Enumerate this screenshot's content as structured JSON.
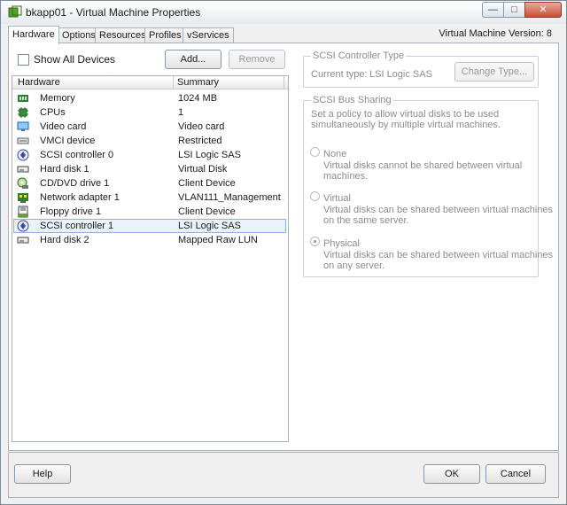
{
  "window": {
    "title": "bkapp01 - Virtual Machine Properties",
    "minimize": "—",
    "maximize": "□",
    "close": "✕"
  },
  "tabs": [
    {
      "label": "Hardware",
      "active": true
    },
    {
      "label": "Options"
    },
    {
      "label": "Resources"
    },
    {
      "label": "Profiles"
    },
    {
      "label": "vServices"
    }
  ],
  "vm_version": "Virtual Machine Version: 8",
  "show_all_devices": {
    "label": "Show All Devices",
    "checked": false
  },
  "buttons": {
    "add": "Add...",
    "remove": "Remove",
    "help": "Help",
    "ok": "OK",
    "cancel": "Cancel",
    "change_type": "Change Type..."
  },
  "hardware_list": {
    "columns": [
      "Hardware",
      "Summary"
    ],
    "rows": [
      {
        "icon": "memory-icon",
        "name": "Memory",
        "summary": "1024 MB"
      },
      {
        "icon": "cpu-icon",
        "name": "CPUs",
        "summary": "1"
      },
      {
        "icon": "video-card-icon",
        "name": "Video card",
        "summary": "Video card"
      },
      {
        "icon": "vmci-device-icon",
        "name": "VMCI device",
        "summary": "Restricted"
      },
      {
        "icon": "scsi-controller-icon",
        "name": "SCSI controller 0",
        "summary": "LSI Logic SAS"
      },
      {
        "icon": "hard-disk-icon",
        "name": "Hard disk 1",
        "summary": "Virtual Disk"
      },
      {
        "icon": "cd-dvd-icon",
        "name": "CD/DVD drive 1",
        "summary": "Client Device"
      },
      {
        "icon": "network-adapter-icon",
        "name": "Network adapter 1",
        "summary": "VLAN111_Management ..."
      },
      {
        "icon": "floppy-drive-icon",
        "name": "Floppy drive 1",
        "summary": "Client Device"
      },
      {
        "icon": "scsi-controller-icon",
        "name": "SCSI controller 1",
        "summary": "LSI Logic SAS",
        "selected": true
      },
      {
        "icon": "hard-disk-icon",
        "name": "Hard disk 2",
        "summary": "Mapped Raw LUN"
      }
    ]
  },
  "scsi_type": {
    "title": "SCSI Controller Type",
    "current_label": "Current type:",
    "current_value": "LSI Logic SAS"
  },
  "bus_sharing": {
    "title": "SCSI Bus Sharing",
    "description": [
      "Set a policy to allow virtual disks to be used",
      "simultaneously by multiple virtual machines."
    ],
    "options": [
      {
        "label": "None",
        "desc": [
          "Virtual disks cannot be shared between virtual",
          "machines."
        ],
        "checked": false
      },
      {
        "label": "Virtual",
        "desc": [
          "Virtual disks can be shared between virtual machines",
          "on the same server."
        ],
        "checked": false
      },
      {
        "label": "Physical",
        "desc": [
          "Virtual disks can be shared between virtual machines",
          "on any server."
        ],
        "checked": true
      }
    ]
  }
}
